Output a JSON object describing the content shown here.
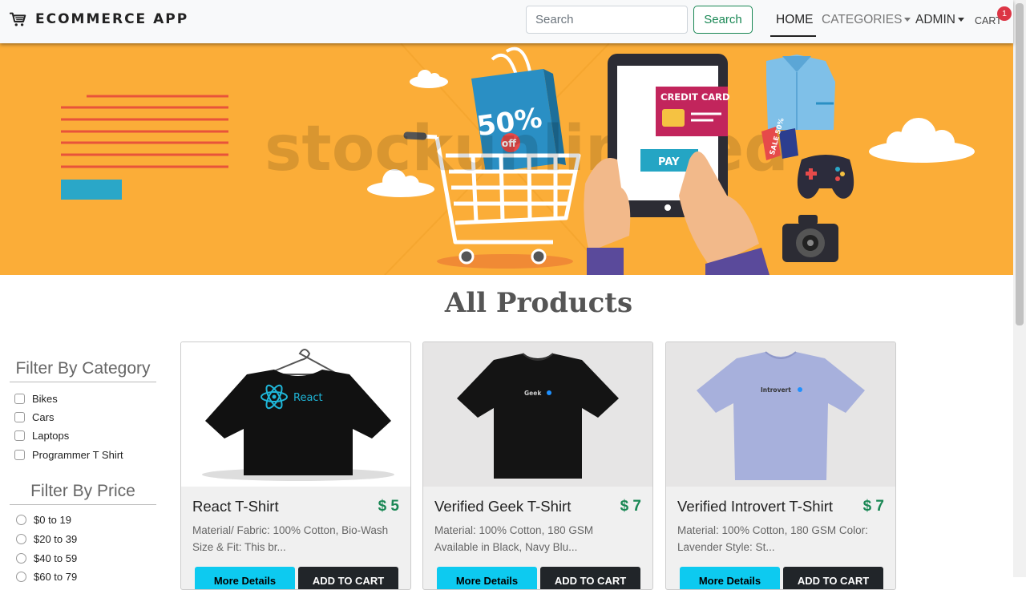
{
  "navbar": {
    "brand": "ECOMMERCE APP",
    "search_placeholder": "Search",
    "search_button": "Search",
    "links": {
      "home": "HOME",
      "categories": "CATEGORIES",
      "admin": "ADMIN",
      "cart": "CART"
    },
    "cart_count": "1"
  },
  "banner": {
    "watermark": "stockunlimited",
    "bag_text": "50%",
    "bag_sub": "off",
    "card_label": "CREDIT CARD",
    "pay_label": "PAY",
    "tag_text": "SALE 50%"
  },
  "main": {
    "title": "All Products"
  },
  "filters": {
    "category_title": "Filter By Category",
    "categories": [
      "Bikes",
      "Cars",
      "Laptops",
      "Programmer T Shirt"
    ],
    "price_title": "Filter By Price",
    "prices": [
      "$0 to 19",
      "$20 to 39",
      "$40 to 59",
      "$60 to 79"
    ]
  },
  "products": [
    {
      "name": "React T-Shirt",
      "price": "$ 5",
      "desc_line1": "Material/ Fabric: 100% Cotton, Bio-Wash",
      "desc_line2": "Size & Fit: This br...",
      "shirt_color": "#111111",
      "print": "React",
      "more": "More Details",
      "add": "ADD TO CART"
    },
    {
      "name": "Verified Geek T-Shirt",
      "price": "$ 7",
      "desc_line1": "Material: 100% Cotton, 180 GSM",
      "desc_line2": "Available in Black, Navy Blu...",
      "shirt_color": "#141414",
      "print": "Geek",
      "more": "More Details",
      "add": "ADD TO CART"
    },
    {
      "name": "Verified Introvert T-Shirt",
      "price": "$ 7",
      "desc_line1": "Material: 100% Cotton, 180 GSM Color:",
      "desc_line2": "Lavender Style: St...",
      "shirt_color": "#a7b0dc",
      "print": "Introvert",
      "more": "More Details",
      "add": "ADD TO CART"
    }
  ],
  "colors": {
    "banner_bg": "#fbad38",
    "success": "#198754",
    "info": "#0dcaf0",
    "dark": "#212529",
    "danger": "#dc3545"
  }
}
